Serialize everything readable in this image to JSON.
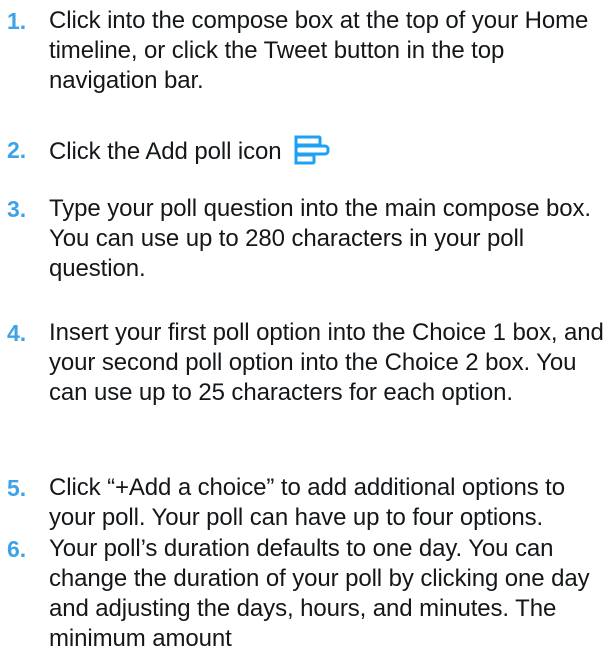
{
  "steps": [
    {
      "num": "1.",
      "text": "Click into the compose box at the top of your Home timeline, or click the Tweet button in the top navigation bar."
    },
    {
      "num": "2.",
      "text": "Click the Add poll icon",
      "icon": "add-poll-icon"
    },
    {
      "num": "3.",
      "text": "Type your poll question into the main compose box. You can use up to 280 characters in your poll question."
    },
    {
      "num": "4.",
      "text": "Insert your first poll option into the Choice 1 box, and your second poll option into the Choice 2 box. You can use up to 25 characters for each option."
    },
    {
      "num": "5.",
      "text": "Click “+Add a choice” to add additional options to your poll. Your poll can have up to four options."
    },
    {
      "num": "6.",
      "text": "Your poll’s duration defaults to one day. You can change the duration of your poll by clicking one day and adjusting the days, hours, and minutes. The minimum amount"
    }
  ],
  "colors": {
    "accent": "#1da1f2",
    "number": "#3fa2e6",
    "text": "#14171a"
  }
}
